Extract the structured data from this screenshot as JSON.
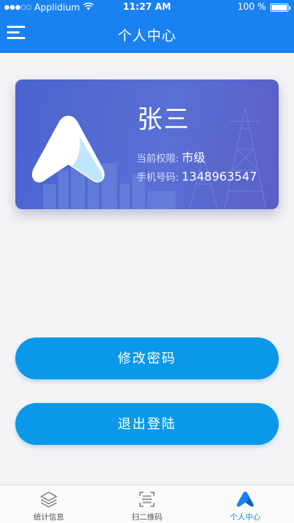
{
  "status_bar": {
    "signal_dots": "●●●○○",
    "carrier": "Applidium",
    "time": "11:27 AM",
    "battery_percent": "100 %",
    "wifi_icon": "wifi-icon",
    "battery_icon": "battery-icon"
  },
  "header": {
    "title": "个人中心",
    "menu_icon": "menu-icon"
  },
  "profile_card": {
    "name": "张三",
    "permission_label": "当前权限:",
    "permission_value": "市级",
    "phone_label": "手机号码:",
    "phone_value": "1348963547"
  },
  "actions": {
    "change_password": "修改密码",
    "logout": "退出登陆"
  },
  "tabbar": {
    "items": [
      {
        "label": "统计信息",
        "icon": "layers-icon",
        "active": false
      },
      {
        "label": "扫二维码",
        "icon": "scan-icon",
        "active": false
      },
      {
        "label": "个人中心",
        "icon": "app-logo-icon",
        "active": true
      }
    ]
  },
  "colors": {
    "primary": "#1a82f0",
    "button": "#0a99ea",
    "card_gradient_start": "#4a63d0",
    "card_gradient_end": "#5a5fc6"
  }
}
